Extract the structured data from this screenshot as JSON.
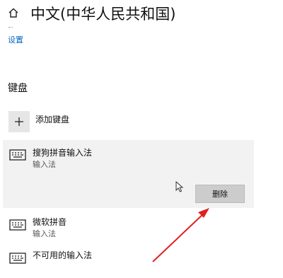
{
  "header": {
    "title": "中文(中华人民共和国)",
    "settings_link": "设置"
  },
  "section": {
    "title": "键盘"
  },
  "add_keyboard": {
    "label": "添加键盘"
  },
  "keyboards": [
    {
      "name": "搜狗拼音输入法",
      "subtitle": "输入法",
      "selected": true
    },
    {
      "name": "微软拼音",
      "subtitle": "输入法",
      "selected": false
    },
    {
      "name": "不可用的输入法",
      "subtitle": "",
      "selected": false
    }
  ],
  "actions": {
    "delete_label": "删除"
  },
  "colors": {
    "link": "#0067c0",
    "annotation_arrow": "#e02020",
    "selected_bg": "#f2f2f2"
  },
  "icons": [
    "home-icon",
    "plus-icon",
    "keyboard-icon",
    "mouse-cursor-icon"
  ]
}
